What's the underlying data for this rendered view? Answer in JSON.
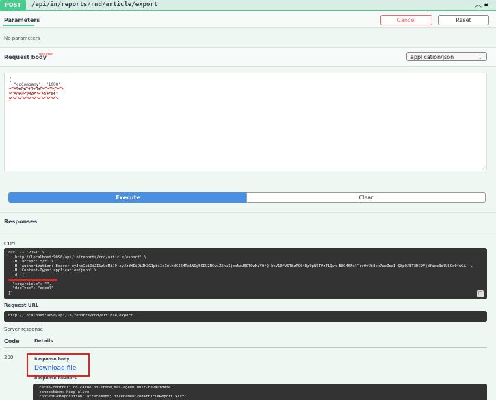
{
  "header": {
    "method": "POST",
    "path": "/api/in/reports/rnd/article/export",
    "collapse_icon": "chevron-up-icon",
    "lock_icon": "lock-icon"
  },
  "parameters": {
    "tab_label": "Parameters",
    "cancel_label": "Cancel",
    "reset_label": "Reset",
    "empty_text": "No parameters"
  },
  "request_body": {
    "title": "Request body",
    "required_label": "required",
    "content_type": "application/json",
    "lines": [
      "{",
      "  \"coCompany\": \"1000\",",
      "  \"seqArticle\": \"\",",
      "  \"docType\": \"excel\"",
      "}"
    ]
  },
  "actions": {
    "execute_label": "Execute",
    "clear_label": "Clear"
  },
  "responses": {
    "title": "Responses",
    "curl_label": "Curl",
    "curl_text": "curl -X 'POST' \\\n  'http://localhost:9090/api/in/reports/rnd/article/export' \\\n  -H 'accept: */*' \\\n  -H 'Authorization: Bearer eyJhbGciOiJIUzUxMiJ9.eyJzdWIiOiJhZG1pbiIsImlhdCI6MTc1NDg5ODU2NCwiZXhwIjoxNzU0OTQwNzY0fQ.hhV10FVST8zRQ04Rp9pW5TPzT1Qvn_E8G46FnlTrr0vUt8cx7WeZcaI_Q8pQJBT3DC9FjdfWcc3olU6Cq0fwGA' \\\n  -H 'Content-Type: application/json' \\\n  -d '{\n\n  \"seqArticle\": \"\",\n  \"docType\": \"excel\"\n}'",
    "request_url_label": "Request URL",
    "request_url": "http://localhost:9090/api/in/reports/rnd/article/export",
    "server_response_label": "Server response",
    "code_header": "Code",
    "details_header": "Details",
    "code": "200",
    "response_body_label": "Response body",
    "download_label": "Download file",
    "response_headers_label": "Response headers",
    "headers_text": " cache-control: no-cache,no-store,max-age=0,must-revalidate\n connection: keep-alive\n content-disposition: attachment; filename=\"rndArticleReport.xlsx\""
  },
  "colors": {
    "post_green": "#49cc90",
    "execute_blue": "#4990e2",
    "annotation_red": "#e62222"
  }
}
